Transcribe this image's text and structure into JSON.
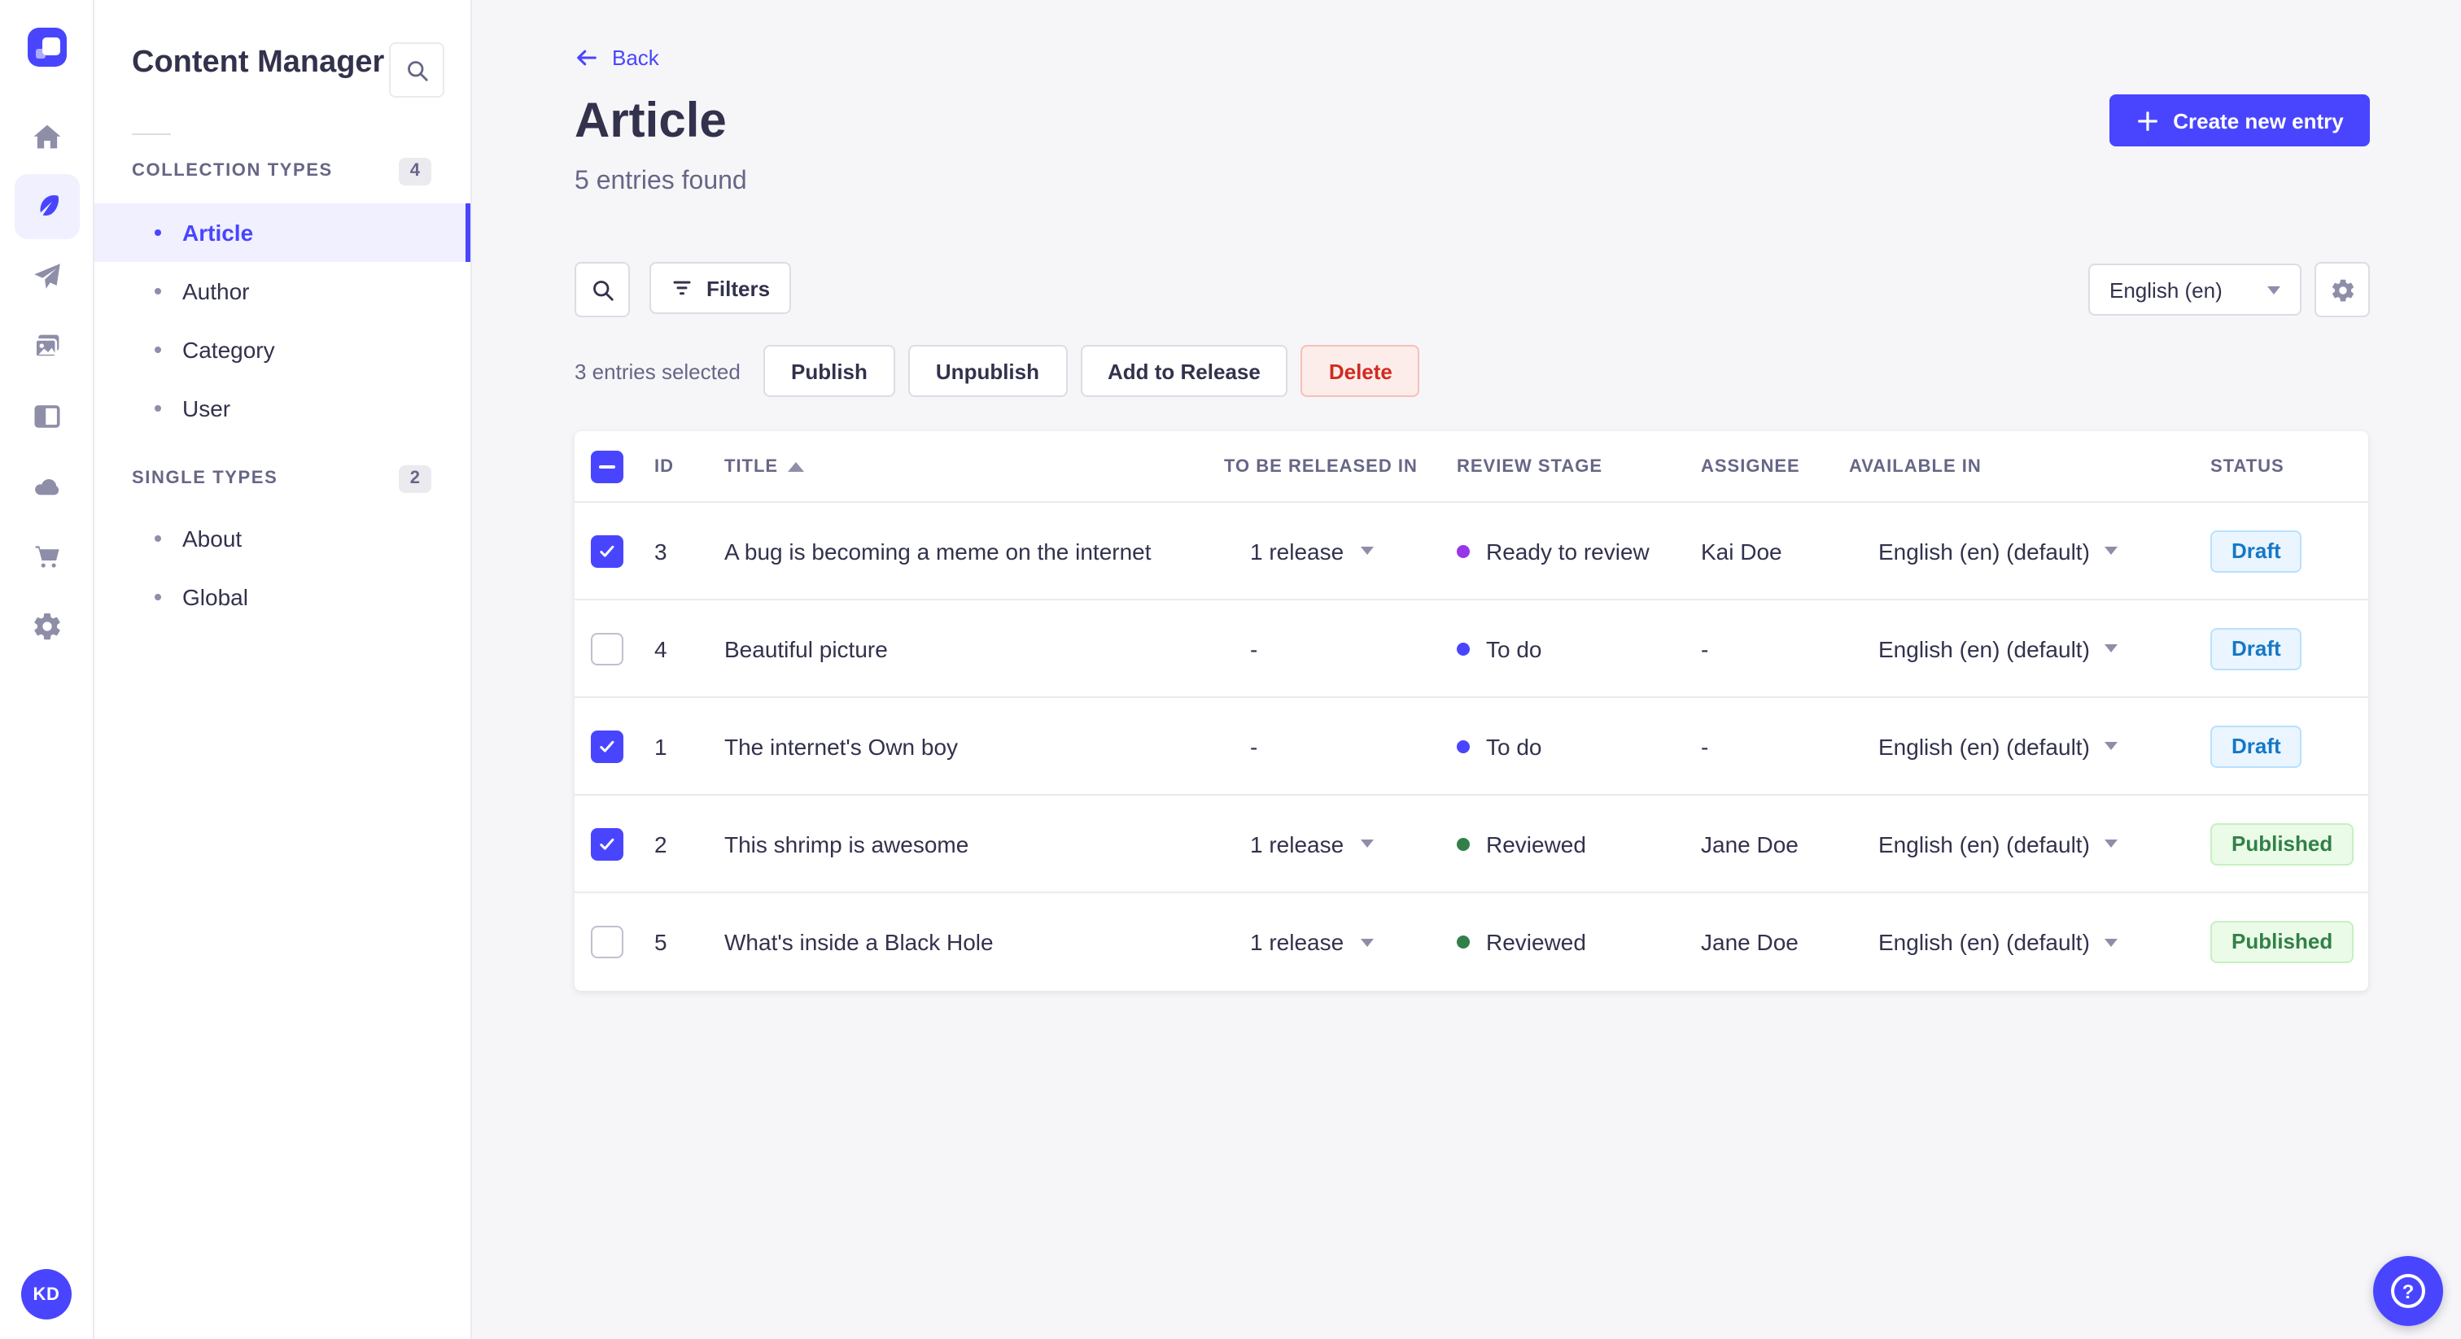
{
  "app": {
    "brand_color": "#4945ff",
    "page_bg": "#f6f6f9",
    "avatar_initials": "KD",
    "help_glyph": "?"
  },
  "sidebar": {
    "title": "Content Manager",
    "sections": [
      {
        "label": "COLLECTION TYPES",
        "count": "4",
        "items": [
          {
            "label": "Article",
            "active": true
          },
          {
            "label": "Author",
            "active": false
          },
          {
            "label": "Category",
            "active": false
          },
          {
            "label": "User",
            "active": false
          }
        ]
      },
      {
        "label": "SINGLE TYPES",
        "count": "2",
        "items": [
          {
            "label": "About",
            "active": false
          },
          {
            "label": "Global",
            "active": false
          }
        ]
      }
    ]
  },
  "header": {
    "back_label": "Back",
    "title": "Article",
    "subtitle": "5 entries found",
    "create_button_label": "Create new entry"
  },
  "toolbar": {
    "filters_label": "Filters",
    "locale_value": "English (en)"
  },
  "selection": {
    "text": "3 entries selected",
    "actions": [
      "Publish",
      "Unpublish",
      "Add to Release"
    ],
    "delete_label": "Delete"
  },
  "table": {
    "columns": [
      "ID",
      "TITLE",
      "TO BE RELEASED IN",
      "REVIEW STAGE",
      "ASSIGNEE",
      "AVAILABLE IN",
      "STATUS"
    ],
    "rows": [
      {
        "checked": true,
        "id": "3",
        "title": "A bug is becoming a meme on the internet",
        "release": "1 release",
        "stage": "Ready to review",
        "stage_color": "#9736e8",
        "assignee": "Kai Doe",
        "locale": "English (en) (default)",
        "status": "Draft"
      },
      {
        "checked": false,
        "id": "4",
        "title": "Beautiful picture",
        "release": "-",
        "stage": "To do",
        "stage_color": "#4945ff",
        "assignee": "-",
        "locale": "English (en) (default)",
        "status": "Draft"
      },
      {
        "checked": true,
        "id": "1",
        "title": "The internet's Own boy",
        "release": "-",
        "stage": "To do",
        "stage_color": "#4945ff",
        "assignee": "-",
        "locale": "English (en) (default)",
        "status": "Draft"
      },
      {
        "checked": true,
        "id": "2",
        "title": "This shrimp is awesome",
        "release": "1 release",
        "stage": "Reviewed",
        "stage_color": "#328048",
        "assignee": "Jane Doe",
        "locale": "English (en) (default)",
        "status": "Published"
      },
      {
        "checked": false,
        "id": "5",
        "title": "What's inside a Black Hole",
        "release": "1 release",
        "stage": "Reviewed",
        "stage_color": "#328048",
        "assignee": "Jane Doe",
        "locale": "English (en) (default)",
        "status": "Published"
      }
    ]
  }
}
